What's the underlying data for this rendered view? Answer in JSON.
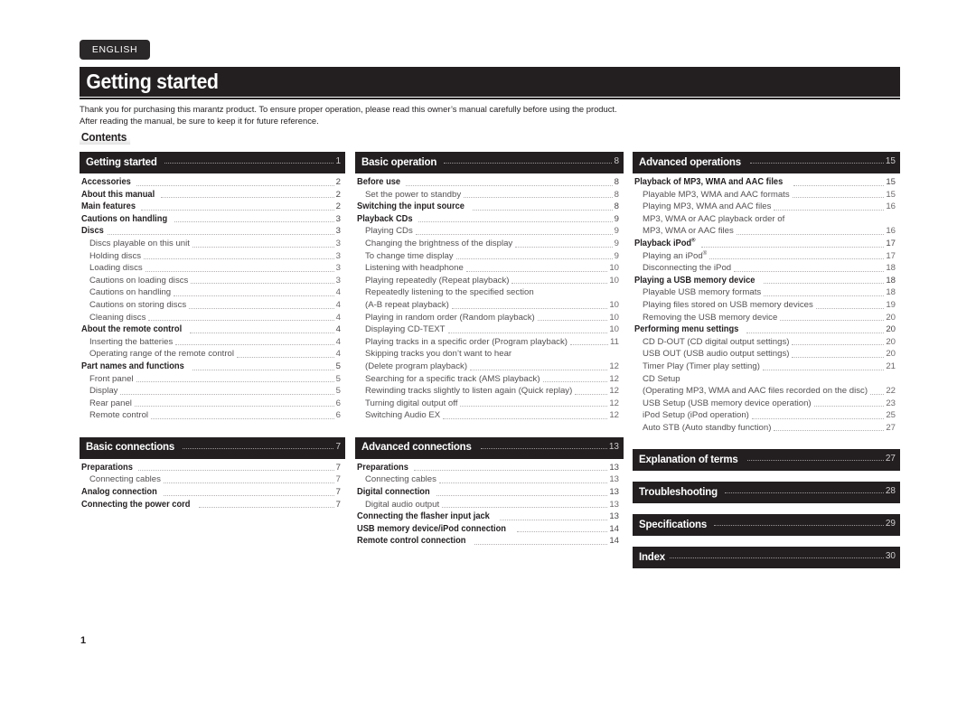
{
  "language_tab": "ENGLISH",
  "chapter_title": "Getting started",
  "intro": {
    "line1": "Thank you for purchasing this marantz product. To ensure proper operation, please read this owner’s manual carefully before using the product.",
    "line2": "After reading the manual, be sure to keep it for future reference."
  },
  "contents_heading": "Contents",
  "page_number": "1",
  "columns": [
    {
      "id": "column-1",
      "sections": [
        {
          "id": "getting-started",
          "title": "Getting started",
          "page": "1",
          "entries": [
            {
              "level": 1,
              "label": "Accessories",
              "page": "2"
            },
            {
              "level": 1,
              "label": "About this manual",
              "page": "2"
            },
            {
              "level": 1,
              "label": "Main features",
              "page": "2"
            },
            {
              "level": 1,
              "label": "Cautions on handling",
              "page": "3"
            },
            {
              "level": 1,
              "label": "Discs",
              "page": "3"
            },
            {
              "level": 2,
              "label": "Discs playable on this unit",
              "page": "3"
            },
            {
              "level": 2,
              "label": "Holding discs",
              "page": "3"
            },
            {
              "level": 2,
              "label": "Loading discs",
              "page": "3"
            },
            {
              "level": 2,
              "label": "Cautions on loading discs",
              "page": "3"
            },
            {
              "level": 2,
              "label": "Cautions on handling",
              "page": "4"
            },
            {
              "level": 2,
              "label": "Cautions on storing discs",
              "page": "4"
            },
            {
              "level": 2,
              "label": "Cleaning discs",
              "page": "4"
            },
            {
              "level": 1,
              "label": "About the remote control",
              "page": "4"
            },
            {
              "level": 2,
              "label": "Inserting the batteries",
              "page": "4"
            },
            {
              "level": 2,
              "label": "Operating range of the remote control",
              "page": "4"
            },
            {
              "level": 1,
              "label": "Part names and functions",
              "page": "5"
            },
            {
              "level": 2,
              "label": "Front panel",
              "page": "5"
            },
            {
              "level": 2,
              "label": "Display",
              "page": "5"
            },
            {
              "level": 2,
              "label": "Rear panel",
              "page": "6"
            },
            {
              "level": 2,
              "label": "Remote control",
              "page": "6"
            }
          ]
        },
        {
          "id": "basic-connections",
          "title": "Basic connections",
          "page": "7",
          "entries": [
            {
              "level": 1,
              "label": "Preparations",
              "page": "7"
            },
            {
              "level": 2,
              "label": "Connecting cables",
              "page": "7"
            },
            {
              "level": 1,
              "label": "Analog connection",
              "page": "7"
            },
            {
              "level": 1,
              "label": "Connecting the power cord",
              "page": "7"
            }
          ]
        }
      ]
    },
    {
      "id": "column-2",
      "sections": [
        {
          "id": "basic-operation",
          "title": "Basic operation",
          "page": "8",
          "entries": [
            {
              "level": 1,
              "label": "Before use",
              "page": "8"
            },
            {
              "level": 2,
              "label": "Set the power to standby",
              "page": "8"
            },
            {
              "level": 1,
              "label": "Switching the input source",
              "page": "8"
            },
            {
              "level": 1,
              "label": "Playback CDs",
              "page": "9"
            },
            {
              "level": 2,
              "label": "Playing CDs",
              "page": "9"
            },
            {
              "level": 2,
              "label": "Changing the brightness of the display",
              "page": "9"
            },
            {
              "level": 2,
              "label": "To change time display",
              "page": "9"
            },
            {
              "level": 2,
              "label": "Listening with headphone",
              "page": "10"
            },
            {
              "level": 2,
              "label": "Playing repeatedly (Repeat playback)",
              "page": "10"
            },
            {
              "level": 2,
              "label": "Repeatedly listening to the specified section",
              "page": "",
              "nopage": true
            },
            {
              "level": 2,
              "label": "(A-B repeat playback)",
              "page": "10"
            },
            {
              "level": 2,
              "label": "Playing in random order (Random playback)",
              "page": "10"
            },
            {
              "level": 2,
              "label": "Displaying CD-TEXT",
              "page": "10"
            },
            {
              "level": 2,
              "label": "Playing tracks in a specific order (Program playback)",
              "page": "11"
            },
            {
              "level": 2,
              "label": "Skipping tracks you don’t want to hear",
              "page": "",
              "nopage": true
            },
            {
              "level": 2,
              "label": "(Delete program playback)",
              "page": "12"
            },
            {
              "level": 2,
              "label": "Searching for a specific track (AMS playback)",
              "page": "12"
            },
            {
              "level": 2,
              "label": "Rewinding tracks slightly to listen again (Quick replay)",
              "page": "12"
            },
            {
              "level": 2,
              "label": "Turning digital output off",
              "page": "12"
            },
            {
              "level": 2,
              "label": "Switching Audio EX",
              "page": "12"
            }
          ]
        },
        {
          "id": "advanced-connections",
          "title": "Advanced connections",
          "page": "13",
          "entries": [
            {
              "level": 1,
              "label": "Preparations",
              "page": "13"
            },
            {
              "level": 2,
              "label": "Connecting cables",
              "page": "13"
            },
            {
              "level": 1,
              "label": "Digital connection",
              "page": "13"
            },
            {
              "level": 2,
              "label": "Digital audio output",
              "page": "13"
            },
            {
              "level": 1,
              "label": "Connecting the flasher input jack",
              "page": "13"
            },
            {
              "level": 1,
              "label": "USB memory device/iPod connection",
              "page": "14"
            },
            {
              "level": 1,
              "label": "Remote control connection",
              "page": "14"
            }
          ]
        }
      ]
    },
    {
      "id": "column-3",
      "sections": [
        {
          "id": "advanced-operations",
          "title": "Advanced operations",
          "page": "15",
          "entries": [
            {
              "level": 1,
              "label": "Playback of MP3, WMA and AAC files",
              "page": "15"
            },
            {
              "level": 2,
              "label": "Playable MP3, WMA and AAC formats",
              "page": "15"
            },
            {
              "level": 2,
              "label": "Playing MP3, WMA and AAC files",
              "page": "16"
            },
            {
              "level": 2,
              "label": "MP3, WMA or AAC playback order of",
              "page": "",
              "nopage": true
            },
            {
              "level": 2,
              "label": "MP3, WMA or AAC files",
              "page": "16"
            },
            {
              "level": 1,
              "label": "Playback iPod",
              "sup": "®",
              "page": "17"
            },
            {
              "level": 2,
              "label": "Playing an iPod",
              "sup": "®",
              "page": "17"
            },
            {
              "level": 2,
              "label": "Disconnecting the iPod",
              "page": "18"
            },
            {
              "level": 1,
              "label": "Playing a USB memory device",
              "page": "18"
            },
            {
              "level": 2,
              "label": "Playable USB memory formats",
              "page": "18"
            },
            {
              "level": 2,
              "label": "Playing files stored on USB memory devices",
              "page": "19"
            },
            {
              "level": 2,
              "label": "Removing the USB memory device",
              "page": "20"
            },
            {
              "level": 1,
              "label": "Performing menu settings",
              "page": "20"
            },
            {
              "level": 2,
              "label": "CD D-OUT (CD digital output settings)",
              "page": "20"
            },
            {
              "level": 2,
              "label": "USB OUT (USB audio output settings)",
              "page": "20"
            },
            {
              "level": 2,
              "label": "Timer Play (Timer play setting)",
              "page": "21"
            },
            {
              "level": 2,
              "label": "CD Setup",
              "page": "",
              "nopage": true
            },
            {
              "level": 2,
              "label": "(Operating MP3, WMA and AAC files recorded on the disc)",
              "page": "22"
            },
            {
              "level": 2,
              "label": "USB Setup (USB memory device operation)",
              "page": "23"
            },
            {
              "level": 2,
              "label": "iPod Setup (iPod operation)",
              "page": "25"
            },
            {
              "level": 2,
              "label": "Auto STB (Auto standby function)",
              "page": "27"
            }
          ]
        },
        {
          "id": "explanation-of-terms",
          "title": "Explanation of terms",
          "page": "27",
          "entries": []
        },
        {
          "id": "troubleshooting",
          "title": "Troubleshooting",
          "page": "28",
          "entries": []
        },
        {
          "id": "specifications",
          "title": "Specifications",
          "page": "29",
          "entries": []
        },
        {
          "id": "index",
          "title": "Index",
          "page": "30",
          "entries": []
        }
      ]
    }
  ]
}
